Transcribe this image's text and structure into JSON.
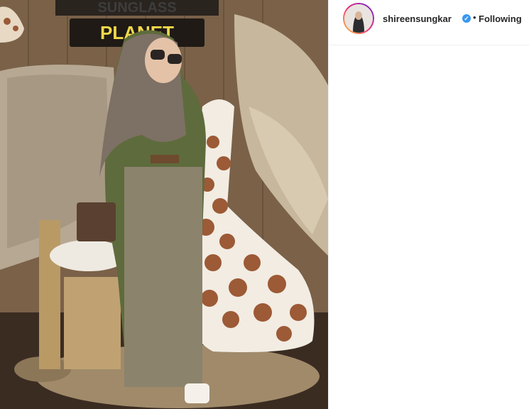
{
  "post": {
    "image": {
      "alt": "",
      "sign_line1": "SUNGLASS",
      "sign_line2": "PLANET"
    },
    "author": {
      "username": "shireensungkar",
      "verified_icon": "verified-badge-icon",
      "separator": "•",
      "follow_label": "Following"
    }
  },
  "colors": {
    "verified_blue": "#3897f0",
    "border": "#efefef",
    "text": "#262626"
  }
}
